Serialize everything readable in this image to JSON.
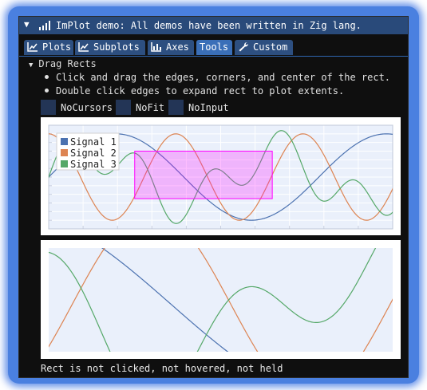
{
  "window": {
    "title": "ImPlot demo: All demos have been written in Zig lang.",
    "accent": "#294a7a"
  },
  "tabs": [
    {
      "label": "Plots",
      "icon": "line-chart-icon"
    },
    {
      "label": "Subplots",
      "icon": "line-chart-icon"
    },
    {
      "label": "Axes",
      "icon": "bar-chart-icon"
    },
    {
      "label": "Tools",
      "icon": ""
    },
    {
      "label": "Custom",
      "icon": "wrench-icon"
    }
  ],
  "active_tab": "Tools",
  "section": {
    "title": "Drag Rects",
    "bullets": [
      "Click and drag the edges, corners, and center of the rect.",
      "Double click edges to expand rect to plot extents."
    ]
  },
  "checkboxes": [
    {
      "label": "NoCursors",
      "checked": false
    },
    {
      "label": "NoFit",
      "checked": false
    },
    {
      "label": "NoInput",
      "checked": false
    }
  ],
  "legend": [
    {
      "name": "Signal 1",
      "color": "#4c72b0"
    },
    {
      "name": "Signal 2",
      "color": "#dd8452"
    },
    {
      "name": "Signal 3",
      "color": "#55a868"
    }
  ],
  "chart_data": [
    {
      "type": "line",
      "role": "main-plot",
      "series": [
        {
          "name": "Signal 1",
          "color": "#4c72b0",
          "function": "y = sin(x*0.8)"
        },
        {
          "name": "Signal 2",
          "color": "#dd8452",
          "function": "y = cos(x*1.7)"
        },
        {
          "name": "Signal 3",
          "color": "#55a868",
          "function": "y = 0.5*sin(x*3) + 0.6*sin(x*1.2)"
        }
      ],
      "xlim": [
        0,
        10
      ],
      "ylim": [
        -1.2,
        1.2
      ],
      "grid": true,
      "legend_position": "top-left",
      "drag_rect": {
        "x": [
          2.5,
          6.5
        ],
        "y": [
          -0.5,
          0.6
        ],
        "color": "#ff00ff"
      }
    },
    {
      "type": "line",
      "role": "rect-view",
      "series": [
        {
          "name": "Signal 1",
          "color": "#4c72b0"
        },
        {
          "name": "Signal 2",
          "color": "#dd8452"
        },
        {
          "name": "Signal 3",
          "color": "#55a868"
        }
      ],
      "xlim": [
        2.5,
        6.5
      ],
      "ylim": [
        -0.5,
        0.6
      ],
      "grid": false
    }
  ],
  "status": "Rect is not clicked, not hovered, not held"
}
